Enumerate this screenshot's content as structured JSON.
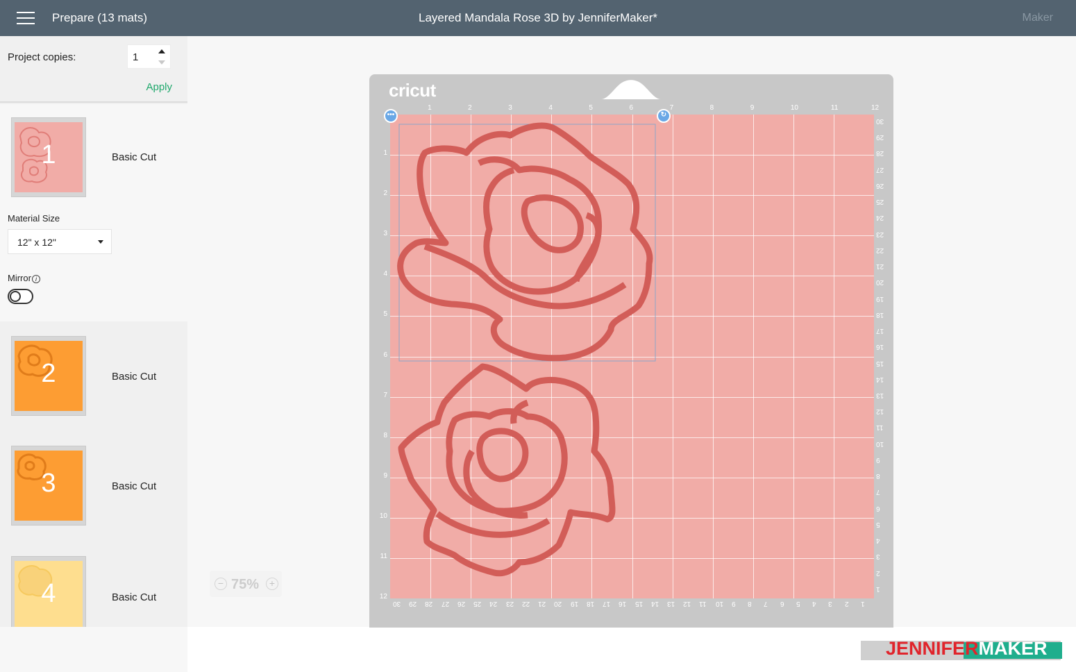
{
  "topbar": {
    "menu_icon": "hamburger-menu-icon",
    "prepare_title": "Prepare (13 mats)",
    "project_title": "Layered Mandala Rose 3D by JenniferMaker*",
    "machine": "Maker"
  },
  "sidebar": {
    "copies_label": "Project copies:",
    "copies_value": "1",
    "apply_label": "Apply",
    "mats": [
      {
        "number": "1",
        "label": "Basic Cut",
        "color": "#f1aca7"
      },
      {
        "number": "2",
        "label": "Basic Cut",
        "color": "#fd9d33"
      },
      {
        "number": "3",
        "label": "Basic Cut",
        "color": "#fd9d33"
      },
      {
        "number": "4",
        "label": "Basic Cut",
        "color": "#fede8f"
      }
    ],
    "material_size_label": "Material Size",
    "material_size_value": "12\" x 12\"",
    "mirror_label": "Mirror",
    "mirror_on": false
  },
  "canvas": {
    "brand": "cricut",
    "zoom_label": "75%",
    "zoom_minus": "−",
    "zoom_plus": "+",
    "top_ruler": [
      "1",
      "2",
      "3",
      "4",
      "5",
      "6",
      "7",
      "8",
      "9",
      "10",
      "11",
      "12"
    ],
    "left_ruler": [
      "1",
      "2",
      "3",
      "4",
      "5",
      "6",
      "7",
      "8",
      "9",
      "10",
      "11",
      "12"
    ],
    "right_ruler": [
      "30",
      "29",
      "28",
      "27",
      "26",
      "25",
      "24",
      "23",
      "22",
      "21",
      "20",
      "19",
      "18",
      "17",
      "16",
      "15",
      "14",
      "13",
      "12",
      "11",
      "10",
      "9",
      "8",
      "7",
      "6",
      "5",
      "4",
      "3",
      "2",
      "1"
    ],
    "bottom_ruler": [
      "30",
      "29",
      "28",
      "27",
      "26",
      "25",
      "24",
      "23",
      "22",
      "21",
      "20",
      "19",
      "18",
      "17",
      "16",
      "15",
      "14",
      "13",
      "12",
      "11",
      "10",
      "9",
      "8",
      "7",
      "6",
      "5",
      "4",
      "3",
      "2",
      "1"
    ],
    "mat_color": "#f1aca7",
    "outline_color": "#d9615d"
  },
  "watermark": {
    "part1": "JENNIFER",
    "part2": "MAKER"
  }
}
